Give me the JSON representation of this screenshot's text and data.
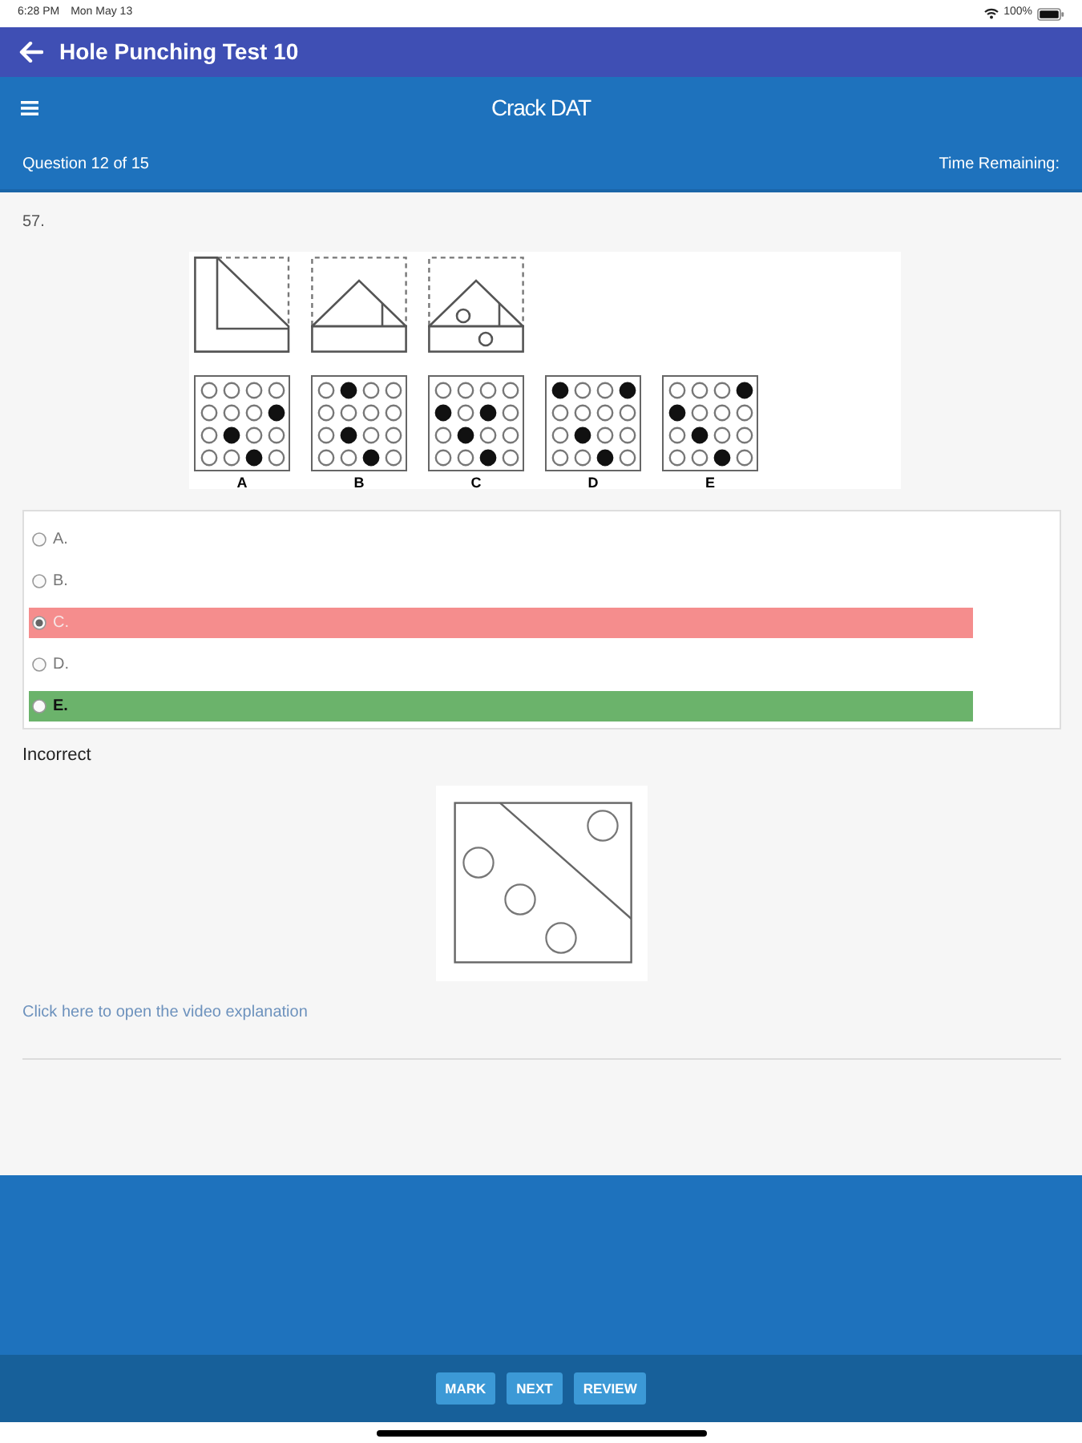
{
  "status_bar": {
    "time": "6:28 PM",
    "date": "Mon May 13",
    "battery": "100%"
  },
  "app_bar": {
    "title": "Hole Punching Test 10"
  },
  "header": {
    "title": "Crack DAT",
    "question_label": "Question 12 of 15",
    "timer_label": "Time Remaining:"
  },
  "question": {
    "number": "57.",
    "figure": {
      "choices": [
        {
          "label": "A",
          "holes": [
            [
              false,
              false,
              false,
              false
            ],
            [
              false,
              false,
              false,
              true
            ],
            [
              false,
              true,
              false,
              false
            ],
            [
              false,
              false,
              true,
              false
            ]
          ]
        },
        {
          "label": "B",
          "holes": [
            [
              false,
              true,
              false,
              false
            ],
            [
              false,
              false,
              false,
              false
            ],
            [
              false,
              true,
              false,
              false
            ],
            [
              false,
              false,
              true,
              false
            ]
          ]
        },
        {
          "label": "C",
          "holes": [
            [
              false,
              false,
              false,
              false
            ],
            [
              true,
              false,
              true,
              false
            ],
            [
              false,
              true,
              false,
              false
            ],
            [
              false,
              false,
              true,
              false
            ]
          ]
        },
        {
          "label": "D",
          "holes": [
            [
              true,
              false,
              false,
              true
            ],
            [
              false,
              false,
              false,
              false
            ],
            [
              false,
              true,
              false,
              false
            ],
            [
              false,
              false,
              true,
              false
            ]
          ]
        },
        {
          "label": "E",
          "holes": [
            [
              false,
              false,
              false,
              true
            ],
            [
              true,
              false,
              false,
              false
            ],
            [
              false,
              true,
              false,
              false
            ],
            [
              false,
              false,
              true,
              false
            ]
          ]
        }
      ]
    }
  },
  "options": [
    {
      "label": "A.",
      "selected": false,
      "correct": false
    },
    {
      "label": "B.",
      "selected": false,
      "correct": false
    },
    {
      "label": "C.",
      "selected": true,
      "correct": false
    },
    {
      "label": "D.",
      "selected": false,
      "correct": false
    },
    {
      "label": "E.",
      "selected": false,
      "correct": true
    }
  ],
  "feedback": "Incorrect",
  "explanation_link": "Click here to open the video explanation",
  "buttons": [
    {
      "label": "MARK"
    },
    {
      "label": "NEXT"
    },
    {
      "label": "REVIEW"
    }
  ]
}
